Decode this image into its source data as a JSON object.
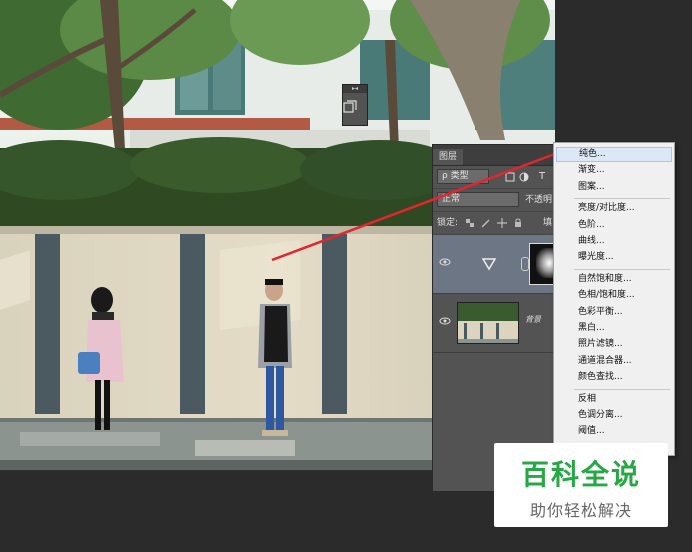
{
  "layers_panel": {
    "tab_label": "图层",
    "filter_label": "ρ 类型",
    "blend_mode": "正常",
    "opacity_label": "不透明",
    "lock_label": "锁定:",
    "fill_label": "填",
    "layers": [
      {
        "name": "",
        "type": "adjustment",
        "selected": true
      },
      {
        "name": "背景",
        "type": "image",
        "selected": false
      }
    ]
  },
  "context_menu": {
    "items": [
      {
        "label": "纯色...",
        "highlight": true
      },
      {
        "label": "渐变..."
      },
      {
        "label": "图案..."
      },
      {
        "sep": true
      },
      {
        "label": "亮度/对比度..."
      },
      {
        "label": "色阶..."
      },
      {
        "label": "曲线..."
      },
      {
        "label": "曝光度..."
      },
      {
        "sep": true
      },
      {
        "label": "自然饱和度..."
      },
      {
        "label": "色相/饱和度..."
      },
      {
        "label": "色彩平衡..."
      },
      {
        "label": "黑白..."
      },
      {
        "label": "照片滤镜..."
      },
      {
        "label": "通道混合器..."
      },
      {
        "label": "颜色查找..."
      },
      {
        "sep": true
      },
      {
        "label": "反相"
      },
      {
        "label": "色调分离..."
      },
      {
        "label": "阈值..."
      }
    ]
  },
  "watermark": {
    "title": "百科全说",
    "subtitle": "助你轻松解决"
  },
  "colors": {
    "arrow": "#e0262f",
    "menu_highlight": "#dde8f6",
    "panel_bg": "#535353",
    "watermark_green": "#27a844"
  }
}
